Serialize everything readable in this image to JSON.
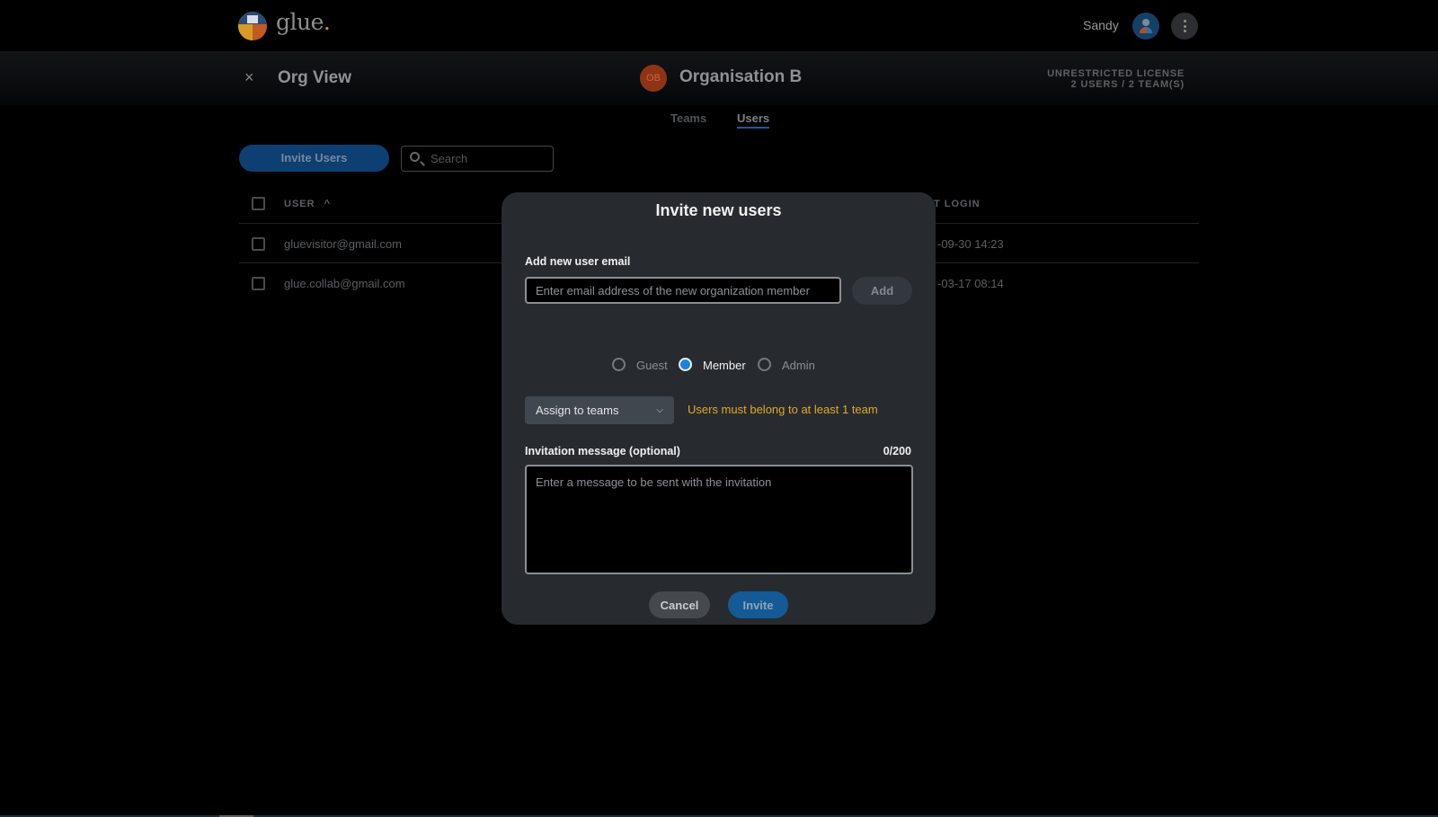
{
  "app": {
    "brand": "glue",
    "brand_dot": ".",
    "user_name": "Sandy",
    "icons": {
      "logo": "glue-logo",
      "avatar": "user-avatar-icon",
      "menu": "kebab-menu-icon"
    }
  },
  "subheader": {
    "close_icon": "×",
    "title": "Org View",
    "org_initials": "OB",
    "org_name": "Organisation B",
    "license_line1": "UNRESTRICTED LICENSE",
    "license_line2": "2 USERS / 2 TEAM(S)"
  },
  "tabs": [
    {
      "label": "Teams",
      "active": false
    },
    {
      "label": "Users",
      "active": true
    }
  ],
  "toolbar": {
    "invite_label": "Invite Users",
    "search_placeholder": "Search"
  },
  "table": {
    "columns": [
      {
        "label": "USER",
        "sort": "ascending",
        "sort_icon": "^"
      },
      {
        "label": "T LOGIN"
      }
    ],
    "rows": [
      {
        "user": "gluevisitor@gmail.com",
        "last_login": "-09-30 14:23"
      },
      {
        "user": "glue.collab@gmail.com",
        "last_login": "-03-17 08:14"
      }
    ]
  },
  "modal": {
    "title": "Invite new users",
    "email_label": "Add new user email",
    "email_value": "",
    "email_placeholder": "Enter email address of the new organization member",
    "add_label": "Add",
    "roles": [
      {
        "label": "Guest",
        "selected": false
      },
      {
        "label": "Member",
        "selected": true
      },
      {
        "label": "Admin",
        "selected": false
      }
    ],
    "assign_label": "Assign to teams",
    "assign_chevron": "⌄",
    "warning": "Users must belong to at least 1 team",
    "warning_color": "#e0a82a",
    "message_label": "Invitation message (optional)",
    "message_counter": "0/200",
    "message_value": "",
    "message_placeholder": "Enter a message to be sent with the invitation",
    "cancel_label": "Cancel",
    "invite_label": "Invite"
  }
}
